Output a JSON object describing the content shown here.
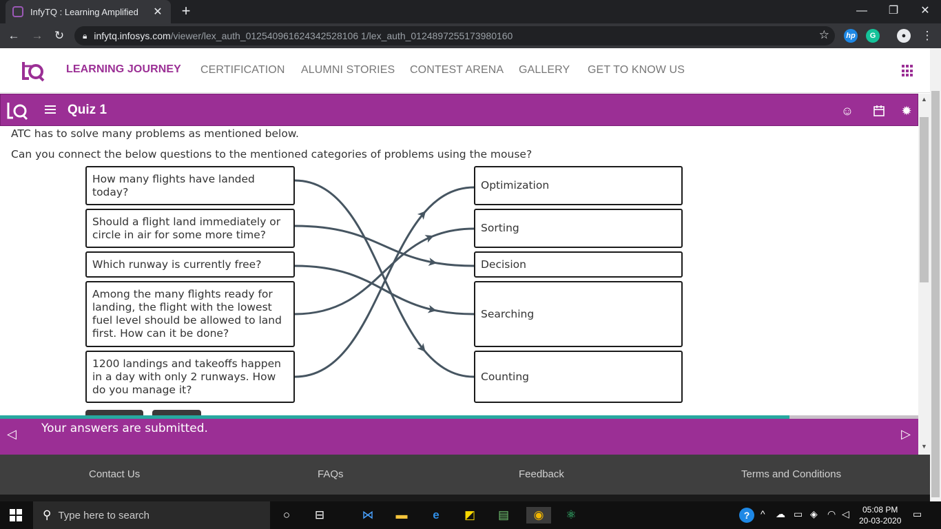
{
  "browser": {
    "tab_title": "InfyTQ : Learning Amplified",
    "tab_close": "✕",
    "new_tab": "+",
    "url_host": "infytq.infosys.com",
    "url_path": "/viewer/lex_auth_012540961624342528106 1/lex_auth_0124897255173980160",
    "minimize": "—",
    "restore": "❐",
    "close": "✕"
  },
  "site_nav": {
    "items": [
      "LEARNING JOURNEY",
      "CERTIFICATION",
      "ALUMNI STORIES",
      "CONTEST ARENA",
      "GALLERY",
      "GET TO KNOW US"
    ]
  },
  "quiz": {
    "title": "Quiz 1",
    "intro": "ATC has to solve many problems as mentioned below.",
    "question": "Can you connect the below questions to the mentioned categories of problems using the mouse?",
    "left_items": [
      "How many flights have landed today?",
      "Should a flight land immediately or circle in air for some more time?",
      "Which runway is currently free?",
      "Among the many flights ready for landing, the flight with the lowest fuel level should be allowed to land first. How can it be done?",
      "1200 landings and takeoffs happen in a day with only 2 runways. How do you manage it?"
    ],
    "right_items": [
      "Optimization",
      "Sorting",
      "Decision",
      "Searching",
      "Counting"
    ],
    "connections": [
      {
        "from": 0,
        "to": 4
      },
      {
        "from": 1,
        "to": 2
      },
      {
        "from": 2,
        "to": 3
      },
      {
        "from": 3,
        "to": 1
      },
      {
        "from": 4,
        "to": 0
      }
    ],
    "progress_fraction": 0.86,
    "status": "Your answers are submitted.",
    "prev_arrow": "◁",
    "next_arrow": "▷"
  },
  "footer": {
    "links": [
      "Contact Us",
      "FAQs",
      "Feedback",
      "Terms and Conditions"
    ]
  },
  "taskbar": {
    "search_placeholder": "Type here to search",
    "time": "05:08 PM",
    "date": "20-03-2020"
  },
  "colors": {
    "brand_purple": "#9b2f95",
    "progress_teal": "#27a8a0",
    "connector": "#465561"
  }
}
